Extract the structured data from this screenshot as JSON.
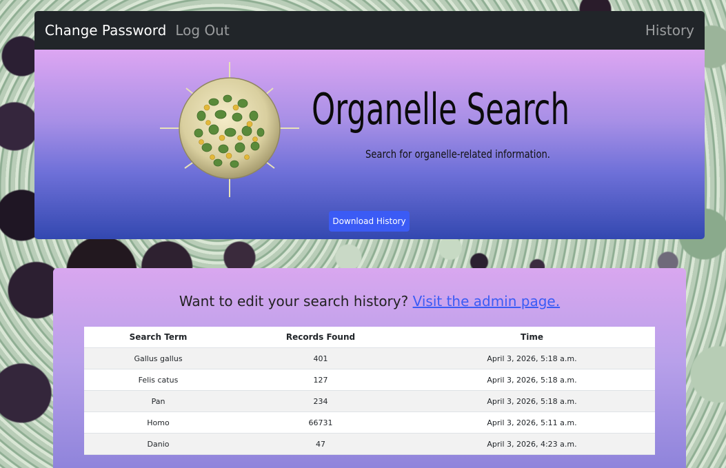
{
  "navbar": {
    "change_password": "Change Password",
    "log_out": "Log Out",
    "history": "History"
  },
  "hero": {
    "title": "Organelle Search",
    "subtitle": "Search for organelle-related information.",
    "download_button": "Download History",
    "logo_icon": "radiolarian-cell-icon"
  },
  "card": {
    "heading_text": "Want to edit your search history?",
    "admin_link": "Visit the admin page."
  },
  "table": {
    "headers": [
      "Search Term",
      "Records Found",
      "Time"
    ],
    "rows": [
      {
        "term": "Gallus gallus",
        "records": "401",
        "time": "April 3, 2026, 5:18 a.m."
      },
      {
        "term": "Felis catus",
        "records": "127",
        "time": "April 3, 2026, 5:18 a.m."
      },
      {
        "term": "Pan",
        "records": "234",
        "time": "April 3, 2026, 5:18 a.m."
      },
      {
        "term": "Homo",
        "records": "66731",
        "time": "April 3, 2026, 5:11 a.m."
      },
      {
        "term": "Danio",
        "records": "47",
        "time": "April 3, 2026, 4:23 a.m."
      }
    ]
  },
  "colors": {
    "navbar_bg": "#212529",
    "button_bg": "#3b5bf5",
    "link": "#3b5bf5"
  }
}
